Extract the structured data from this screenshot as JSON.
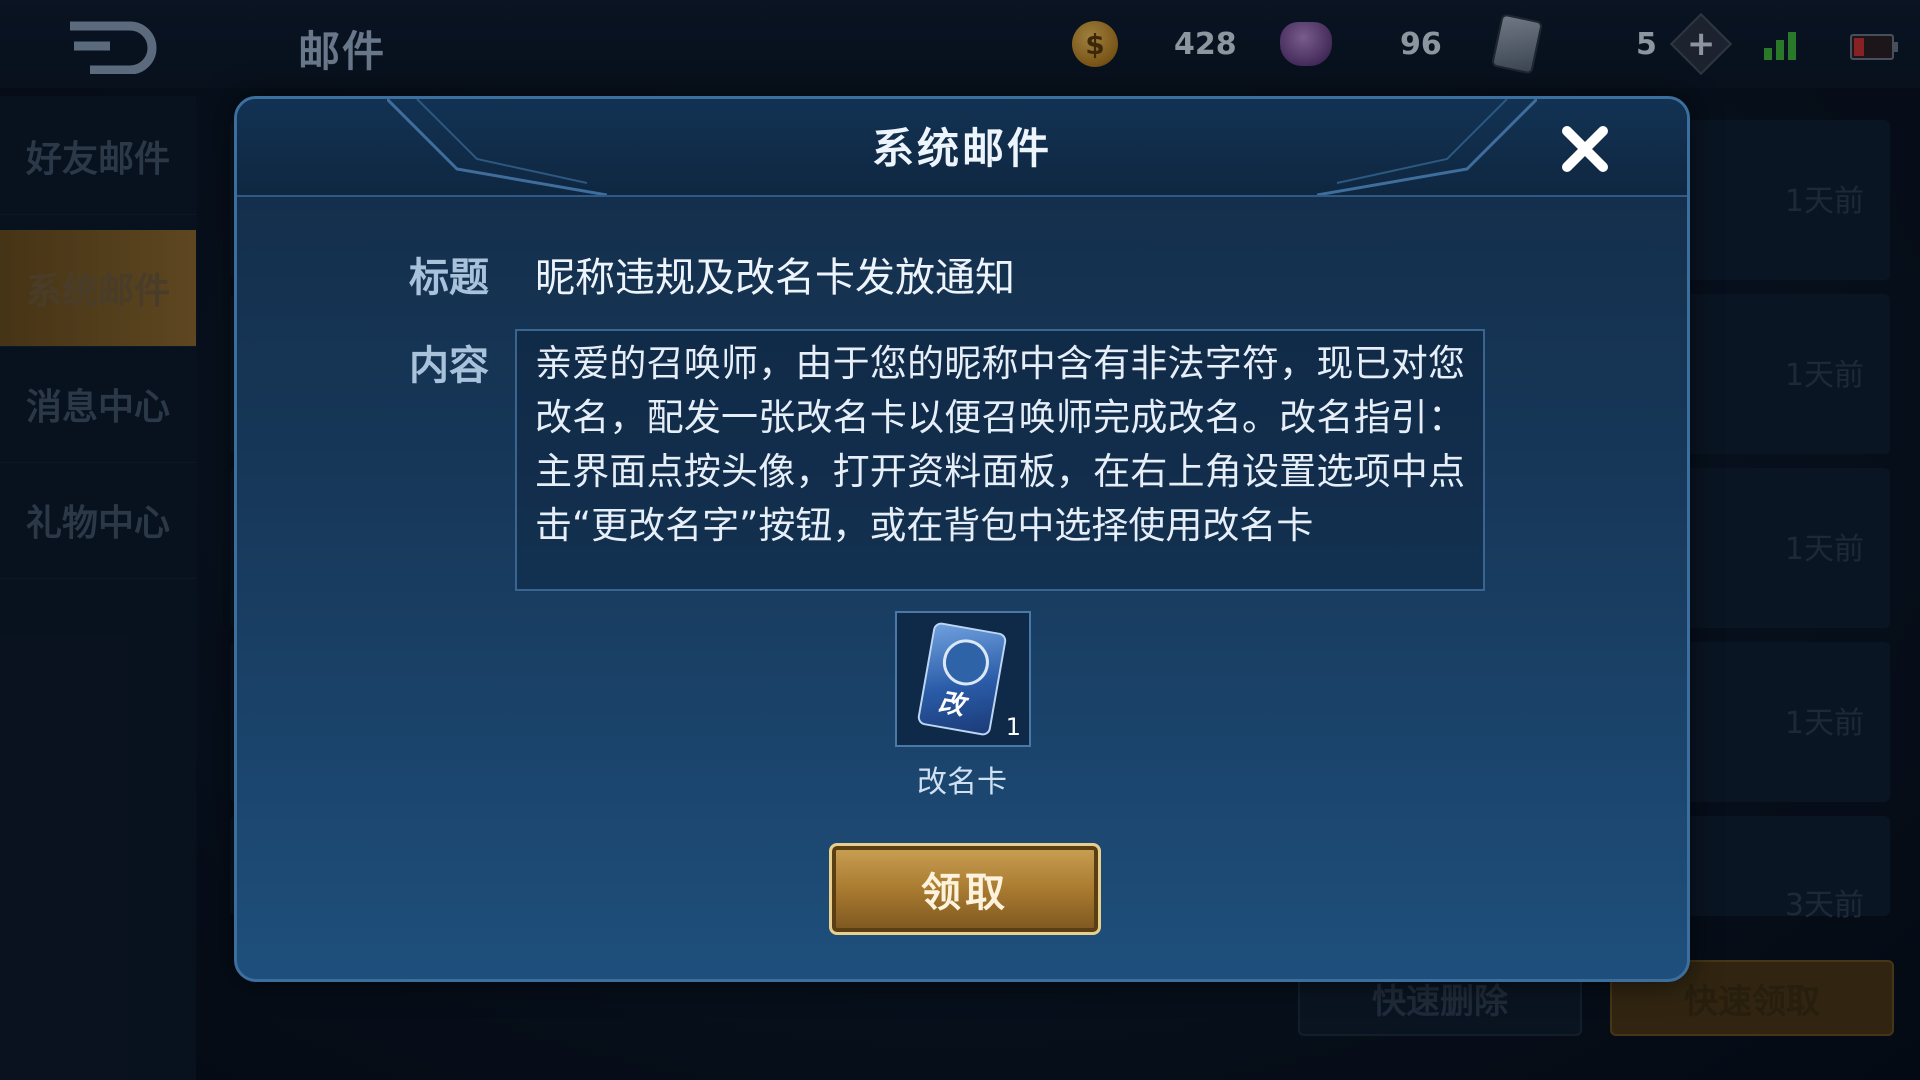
{
  "header": {
    "title": "邮件",
    "resources": {
      "gold": "428",
      "gems": "96",
      "tickets": "5"
    }
  },
  "sidebar": {
    "items": [
      {
        "label": "好友邮件"
      },
      {
        "label": "系统邮件"
      },
      {
        "label": "消息中心"
      },
      {
        "label": "礼物中心"
      }
    ]
  },
  "mail_list": {
    "times": [
      "1天前",
      "1天前",
      "1天前",
      "1天前",
      "3天前"
    ],
    "delete_all_label": "快速删除",
    "claim_all_label": "快速领取"
  },
  "modal": {
    "title": "系统邮件",
    "subject_label": "标题",
    "subject": "昵称违规及改名卡发放通知",
    "content_label": "内容",
    "content": "亲爱的召唤师，由于您的昵称中含有非法字符，现已对您改名，配发一张改名卡以便召唤师完成改名。改名指引：主界面点按头像，打开资料面板，在右上角设置选项中点击“更改名字”按钮，或在背包中选择使用改名卡",
    "attachment": {
      "card_char": "改",
      "count": "1",
      "name": "改名卡"
    },
    "claim_label": "领取"
  },
  "colors": {
    "gold_button": "#a97b30",
    "modal_bg": "#17385a",
    "accent_blue": "#3d6f9e"
  }
}
